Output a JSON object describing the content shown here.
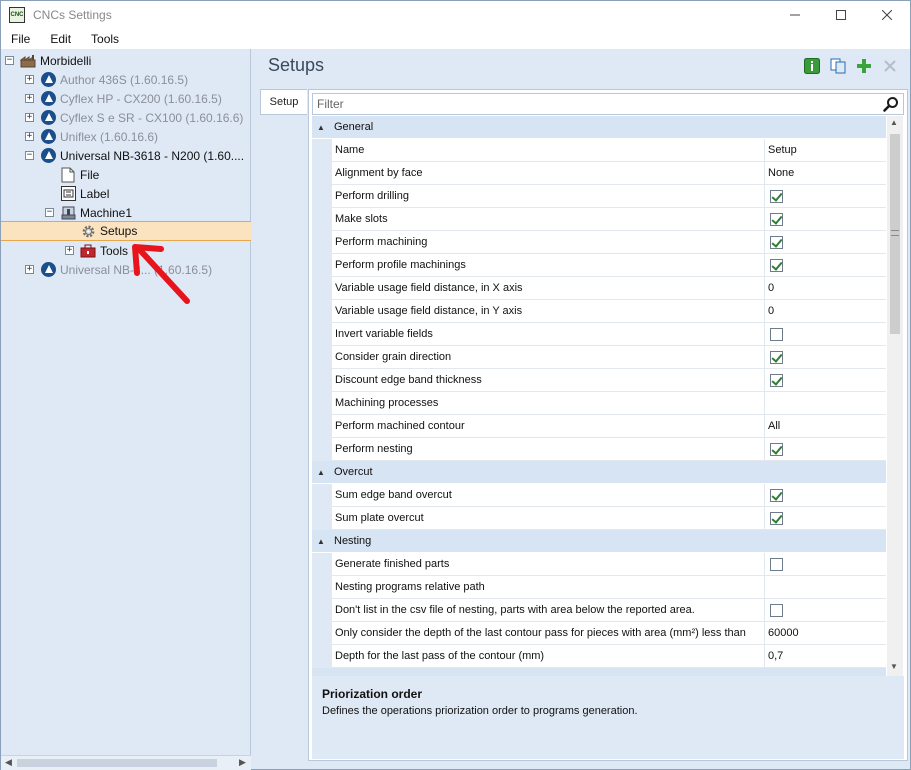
{
  "window": {
    "title": "CNCs Settings",
    "icon_label": "CNC",
    "controls": [
      "minimize-icon",
      "maximize-icon",
      "close-icon"
    ]
  },
  "menu": [
    "File",
    "Edit",
    "Tools"
  ],
  "tree": {
    "root": "Morbidelli",
    "items": [
      {
        "label": "Author 436S (1.60.16.5)",
        "dim": true
      },
      {
        "label": "Cyflex HP - CX200 (1.60.16.5)",
        "dim": true
      },
      {
        "label": "Cyflex S e SR - CX100 (1.60.16.6)",
        "dim": true
      },
      {
        "label": "Uniflex (1.60.16.6)",
        "dim": true
      },
      {
        "label": "Universal NB-3618 - N200 (1.60....",
        "dim": false
      },
      {
        "label": "File",
        "dim": false
      },
      {
        "label": "Label",
        "dim": false
      },
      {
        "label": "Machine1",
        "dim": false
      },
      {
        "label": "Setups",
        "dim": false,
        "selected": true
      },
      {
        "label": "Tools",
        "dim": false
      },
      {
        "label": "Universal NB-3... (1.60.16.5)",
        "dim": true
      }
    ]
  },
  "panel": {
    "title": "Setups",
    "tab": "Setup",
    "filter_placeholder": "Filter",
    "toolbar": [
      "info-icon",
      "copy-icon",
      "add-icon",
      "delete-icon"
    ]
  },
  "categories": [
    {
      "name": "General",
      "rows": [
        {
          "name": "Name",
          "value": "Setup",
          "type": "text"
        },
        {
          "name": "Alignment by face",
          "value": "None",
          "type": "text"
        },
        {
          "name": "Perform drilling",
          "value": true,
          "type": "check"
        },
        {
          "name": "Make slots",
          "value": true,
          "type": "check"
        },
        {
          "name": "Perform machining",
          "value": true,
          "type": "check"
        },
        {
          "name": "Perform profile machinings",
          "value": true,
          "type": "check"
        },
        {
          "name": "Variable usage field distance, in X axis",
          "value": "0",
          "type": "text"
        },
        {
          "name": "Variable usage field distance, in Y axis",
          "value": "0",
          "type": "text"
        },
        {
          "name": "Invert variable fields",
          "value": false,
          "type": "check"
        },
        {
          "name": "Consider grain direction",
          "value": true,
          "type": "check"
        },
        {
          "name": "Discount edge band thickness",
          "value": true,
          "type": "check"
        },
        {
          "name": "Machining processes",
          "value": "",
          "type": "text"
        },
        {
          "name": "Perform machined contour",
          "value": "All",
          "type": "text"
        },
        {
          "name": "Perform nesting",
          "value": true,
          "type": "check"
        }
      ]
    },
    {
      "name": "Overcut",
      "rows": [
        {
          "name": "Sum edge band overcut",
          "value": true,
          "type": "check"
        },
        {
          "name": "Sum plate overcut",
          "value": true,
          "type": "check"
        }
      ]
    },
    {
      "name": "Nesting",
      "rows": [
        {
          "name": "Generate finished parts",
          "value": false,
          "type": "check"
        },
        {
          "name": "Nesting programs relative path",
          "value": "",
          "type": "text"
        },
        {
          "name": "Don't list in the csv file of nesting, parts with area below the reported area.",
          "value": false,
          "type": "check"
        },
        {
          "name": "Only consider the depth of the last contour pass for pieces with area (mm²) less than",
          "value": "60000",
          "type": "text"
        },
        {
          "name": "Depth for the last pass of the contour (mm)",
          "value": "0,7",
          "type": "text"
        }
      ]
    }
  ],
  "description": {
    "title": "Priorization order",
    "text": "Defines the operations priorization order to programs generation."
  },
  "colors": {
    "tree_bg": "#dfe9f5",
    "selection": "#fbe3c0",
    "brand": "#1a4f8c",
    "check": "#2f7d32",
    "annotation_arrow": "#e8141b"
  }
}
